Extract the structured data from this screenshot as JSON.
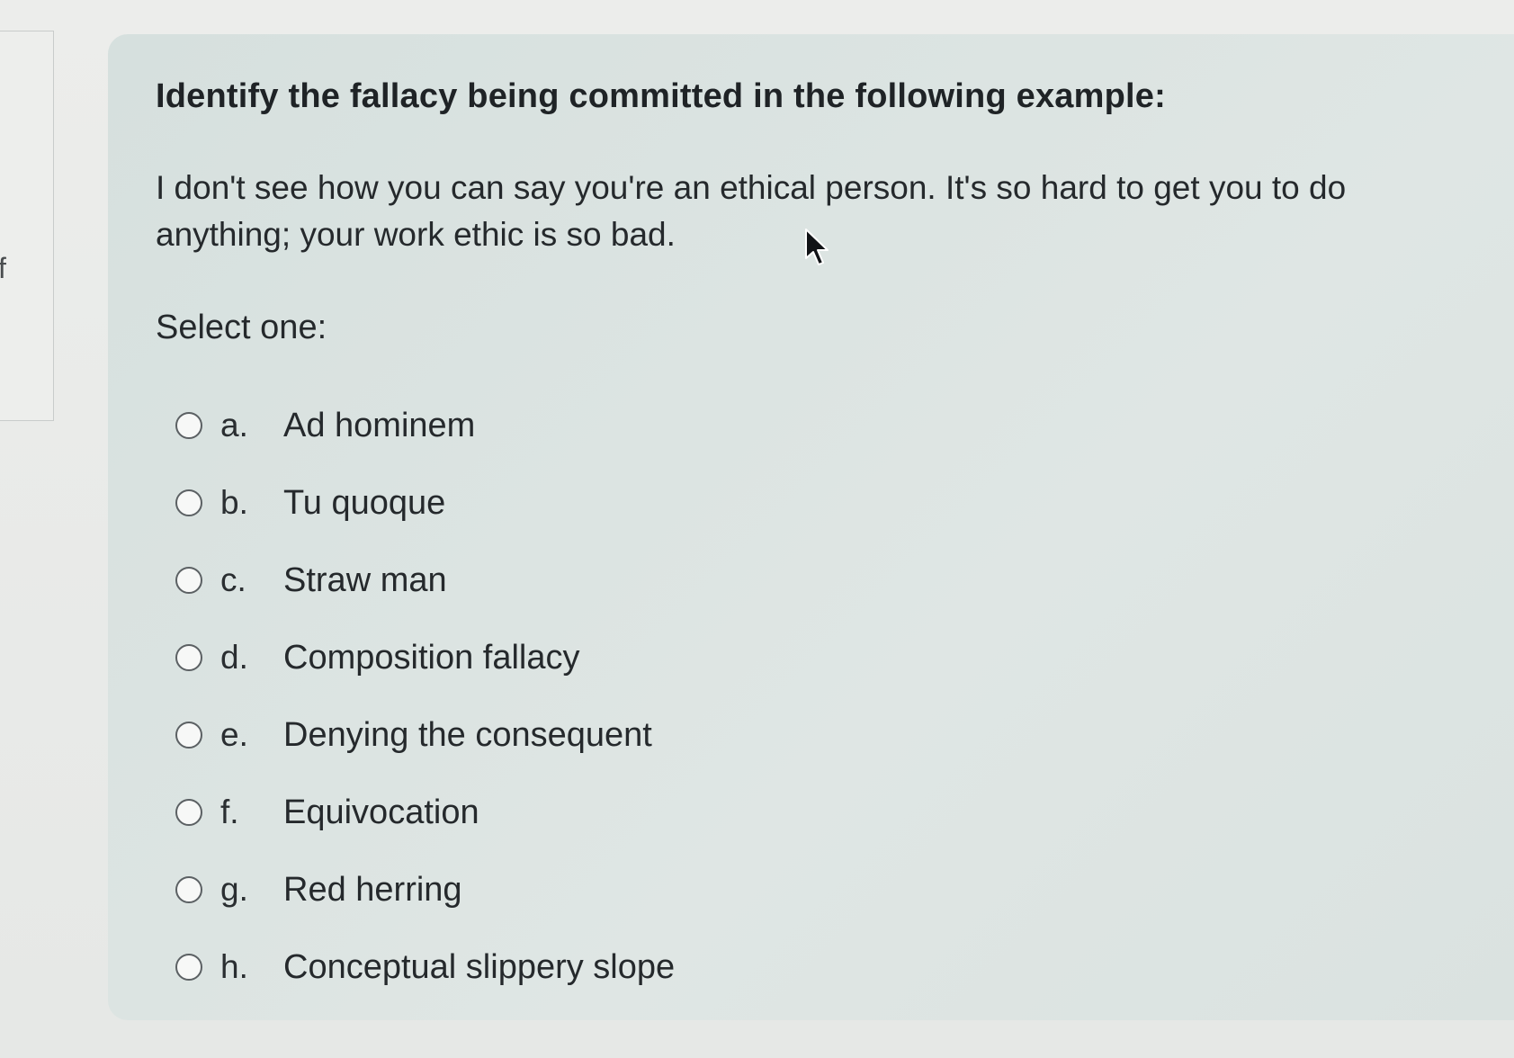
{
  "sidebar": {
    "letter": "f"
  },
  "question": {
    "title": "Identify the fallacy being committed in the following example:",
    "body": "I don't see how you can say you're an ethical person. It's so hard to get you to do anything; your work ethic is so bad.",
    "select_label": "Select one:",
    "options": [
      {
        "letter": "a.",
        "text": "Ad hominem",
        "selected": false
      },
      {
        "letter": "b.",
        "text": "Tu quoque",
        "selected": false
      },
      {
        "letter": "c.",
        "text": "Straw man",
        "selected": false
      },
      {
        "letter": "d.",
        "text": "Composition fallacy",
        "selected": false
      },
      {
        "letter": "e.",
        "text": "Denying the consequent",
        "selected": false
      },
      {
        "letter": "f.",
        "text": "Equivocation",
        "selected": false
      },
      {
        "letter": "g.",
        "text": "Red herring",
        "selected": false
      },
      {
        "letter": "h.",
        "text": "Conceptual slippery slope",
        "selected": false
      }
    ]
  },
  "icons": {
    "cursor": "mouse-pointer-icon",
    "radio": "radio-unchecked-icon"
  },
  "colors": {
    "card_background": "#dbe4e2",
    "page_background": "#e9ebe9",
    "text": "#25292c",
    "radio_border": "#5b6063"
  }
}
